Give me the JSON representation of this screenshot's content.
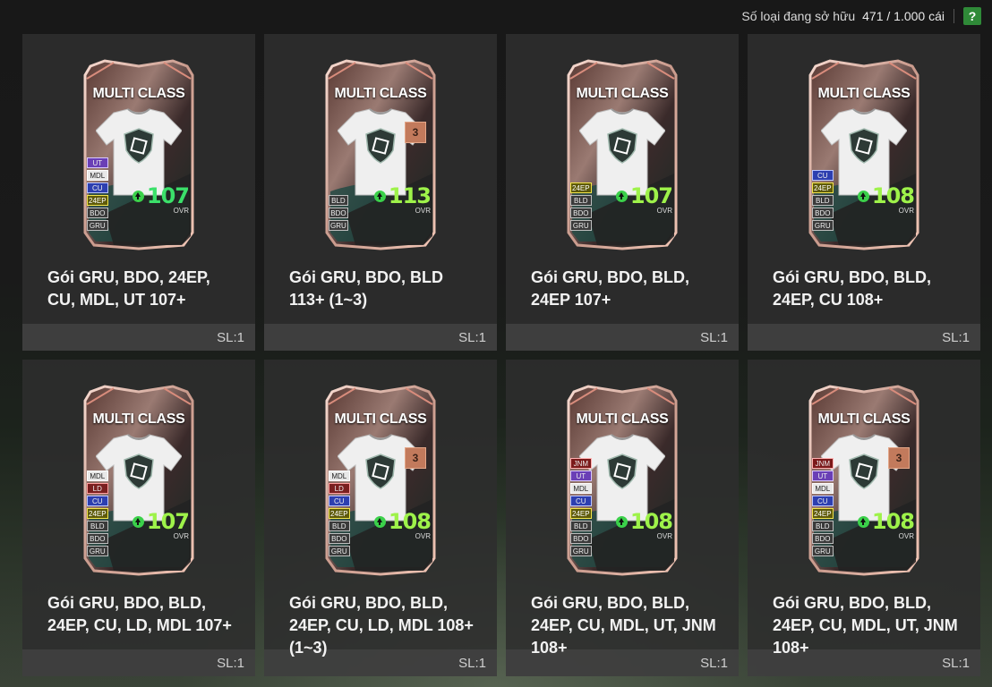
{
  "header": {
    "owned_label": "Số loại đang sở hữu",
    "owned_count": "471 / 1.000 cái",
    "help_label": "?"
  },
  "colors": {
    "accent": "#3bd04a",
    "help_bg": "#2f8a38",
    "ovr": "#9ef24a"
  },
  "items": [
    {
      "card_title": "MULTI CLASS",
      "chips": [
        "UT",
        "MDL",
        "CU",
        "24EP",
        "BDO",
        "GRU"
      ],
      "badge": "",
      "ovr": "107",
      "ovr_label": "OVR",
      "title": "Gói GRU, BDO, 24EP, CU, MDL, UT 107+",
      "qty": "SL:1"
    },
    {
      "card_title": "MULTI CLASS",
      "chips": [
        "BLD",
        "BDO",
        "GRU"
      ],
      "badge": "3",
      "ovr": "113",
      "ovr_label": "OVR",
      "title": "Gói GRU, BDO, BLD 113+ (1~3)",
      "qty": "SL:1"
    },
    {
      "card_title": "MULTI CLASS",
      "chips": [
        "24EP",
        "BLD",
        "BDO",
        "GRU"
      ],
      "badge": "",
      "ovr": "107",
      "ovr_label": "OVR",
      "title": "Gói GRU, BDO, BLD, 24EP 107+",
      "qty": "SL:1"
    },
    {
      "card_title": "MULTI CLASS",
      "chips": [
        "CU",
        "24EP",
        "BLD",
        "BDO",
        "GRU"
      ],
      "badge": "",
      "ovr": "108",
      "ovr_label": "OVR",
      "title": "Gói GRU, BDO, BLD, 24EP, CU 108+",
      "qty": "SL:1"
    },
    {
      "card_title": "MULTI CLASS",
      "chips": [
        "MDL",
        "LD",
        "CU",
        "24EP",
        "BLD",
        "BDO",
        "GRU"
      ],
      "badge": "",
      "ovr": "107",
      "ovr_label": "OVR",
      "title": "Gói GRU, BDO, BLD, 24EP, CU, LD, MDL 107+",
      "qty": "SL:1"
    },
    {
      "card_title": "MULTI CLASS",
      "chips": [
        "MDL",
        "LD",
        "CU",
        "24EP",
        "BLD",
        "BDO",
        "GRU"
      ],
      "badge": "3",
      "ovr": "108",
      "ovr_label": "OVR",
      "title": "Gói GRU, BDO, BLD, 24EP, CU, LD, MDL 108+ (1~3)",
      "qty": "SL:1"
    },
    {
      "card_title": "MULTI CLASS",
      "chips": [
        "JNM",
        "UT",
        "MDL",
        "CU",
        "24EP",
        "BLD",
        "BDO",
        "GRU"
      ],
      "badge": "",
      "ovr": "108",
      "ovr_label": "OVR",
      "title": "Gói GRU, BDO, BLD, 24EP, CU, MDL, UT, JNM 108+",
      "qty": "SL:1"
    },
    {
      "card_title": "MULTI CLASS",
      "chips": [
        "JNM",
        "UT",
        "MDL",
        "CU",
        "24EP",
        "BLD",
        "BDO",
        "GRU"
      ],
      "badge": "3",
      "ovr": "108",
      "ovr_label": "OVR",
      "title": "Gói GRU, BDO, BLD, 24EP, CU, MDL, UT, JNM 108+",
      "qty": "SL:1"
    }
  ]
}
